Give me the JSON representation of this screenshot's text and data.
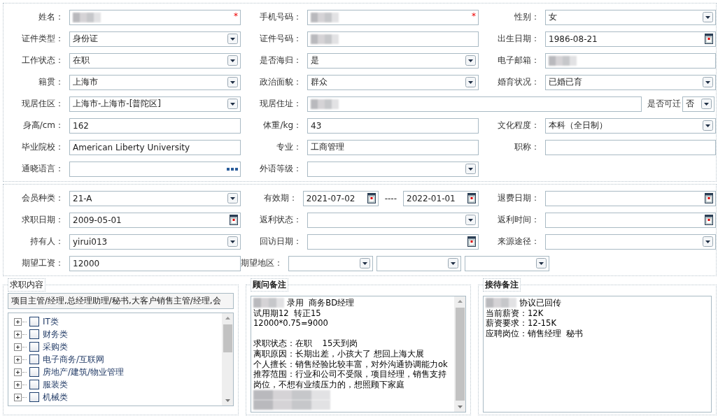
{
  "sections": [
    {
      "rows": [
        {
          "cells": [
            {
              "label": "姓名：",
              "fields": [
                {
                  "kind": "redacted",
                  "marker": "*"
                }
              ]
            },
            {
              "label": "手机号码：",
              "fields": [
                {
                  "kind": "redacted",
                  "marker": "*"
                }
              ]
            },
            {
              "label": "性别：",
              "fields": [
                {
                  "kind": "select",
                  "value": "女"
                }
              ]
            }
          ]
        },
        {
          "cells": [
            {
              "label": "证件类型：",
              "fields": [
                {
                  "kind": "select",
                  "value": "身份证"
                }
              ]
            },
            {
              "label": "证件号码：",
              "fields": [
                {
                  "kind": "redacted"
                }
              ]
            },
            {
              "label": "出生日期：",
              "fields": [
                {
                  "kind": "date",
                  "value": "1986-08-21"
                }
              ]
            }
          ]
        },
        {
          "cells": [
            {
              "label": "工作状态：",
              "fields": [
                {
                  "kind": "select",
                  "value": "在职"
                }
              ]
            },
            {
              "label": "是否海归：",
              "fields": [
                {
                  "kind": "select",
                  "value": "是"
                }
              ]
            },
            {
              "label": "电子邮箱：",
              "fields": [
                {
                  "kind": "redacted"
                }
              ]
            }
          ]
        },
        {
          "cells": [
            {
              "label": "籍贯：",
              "fields": [
                {
                  "kind": "select",
                  "value": "上海市"
                }
              ]
            },
            {
              "label": "政治面貌：",
              "fields": [
                {
                  "kind": "select",
                  "value": "群众"
                }
              ]
            },
            {
              "label": "婚育状况：",
              "fields": [
                {
                  "kind": "select",
                  "value": "已婚已育"
                }
              ]
            }
          ]
        },
        {
          "cells": [
            {
              "label": "现居住区：",
              "fields": [
                {
                  "kind": "select",
                  "value": "上海市-上海市-[普陀区]"
                }
              ]
            },
            {
              "label": "现居住址：",
              "fields": [
                {
                  "kind": "redacted"
                }
              ],
              "inline": {
                "label": "是否可迁",
                "field": {
                  "kind": "select",
                  "value": "否"
                }
              }
            }
          ]
        },
        {
          "cells": [
            {
              "label": "身高/cm：",
              "fields": [
                {
                  "kind": "text",
                  "value": "162"
                }
              ]
            },
            {
              "label": "体重/kg：",
              "fields": [
                {
                  "kind": "text",
                  "value": "43"
                }
              ]
            },
            {
              "label": "文化程度：",
              "fields": [
                {
                  "kind": "select",
                  "value": "本科（全日制）"
                }
              ]
            }
          ]
        },
        {
          "cells": [
            {
              "label": "毕业院校：",
              "fields": [
                {
                  "kind": "text",
                  "value": "American Liberty University"
                }
              ]
            },
            {
              "label": "专业：",
              "fields": [
                {
                  "kind": "text",
                  "value": "工商管理"
                }
              ]
            },
            {
              "label": "职称：",
              "fields": [
                {
                  "kind": "text"
                }
              ]
            }
          ]
        },
        {
          "cells": [
            {
              "label": "通晓语言：",
              "fields": [
                {
                  "kind": "picker"
                }
              ]
            },
            {
              "label": "外语等级：",
              "fields": [
                {
                  "kind": "select"
                }
              ]
            }
          ]
        }
      ]
    },
    {
      "rows": [
        {
          "cells": [
            {
              "label": "会员种类：",
              "fields": [
                {
                  "kind": "select",
                  "value": "21-A"
                }
              ]
            },
            {
              "label": "有效期：",
              "fields": [
                {
                  "kind": "date",
                  "value": "2021-07-02"
                },
                {
                  "kind": "separator",
                  "text": "----"
                },
                {
                  "kind": "date",
                  "value": "2022-01-01"
                }
              ]
            },
            {
              "label": "退费日期：",
              "fields": [
                {
                  "kind": "date"
                }
              ]
            }
          ]
        },
        {
          "cells": [
            {
              "label": "求职日期：",
              "fields": [
                {
                  "kind": "date",
                  "value": "2009-05-01"
                }
              ]
            },
            {
              "label": "返利状态：",
              "fields": [
                {
                  "kind": "select"
                }
              ]
            },
            {
              "label": "返利时间：",
              "fields": [
                {
                  "kind": "date"
                }
              ]
            }
          ]
        },
        {
          "cells": [
            {
              "label": "持有人：",
              "fields": [
                {
                  "kind": "select",
                  "value": "yirui013"
                }
              ]
            },
            {
              "label": "回访日期：",
              "fields": [
                {
                  "kind": "date"
                }
              ]
            },
            {
              "label": "来源途径：",
              "fields": [
                {
                  "kind": "select"
                }
              ]
            }
          ]
        },
        {
          "cells": [
            {
              "label": "期望工资：",
              "fields": [
                {
                  "kind": "text",
                  "value": "12000"
                }
              ]
            },
            {
              "label": "期望地区：",
              "fields": [
                {
                  "kind": "select"
                },
                {
                  "kind": "select"
                },
                {
                  "kind": "select"
                }
              ]
            }
          ]
        }
      ]
    }
  ],
  "job_content": {
    "title": "求职内容",
    "summary": "项目主管/经理,总经理助理/秘书,大客户销售主管/经理,会",
    "tree": [
      {
        "label": "IT类",
        "expanded": false,
        "checked": false
      },
      {
        "label": "财务类",
        "expanded": false,
        "checked": false
      },
      {
        "label": "采购类",
        "expanded": false,
        "checked": false
      },
      {
        "label": "电子商务/互联网",
        "expanded": false,
        "checked": false
      },
      {
        "label": "房地产/建筑/物业管理",
        "expanded": false,
        "checked": false
      },
      {
        "label": "服装类",
        "expanded": false,
        "checked": false
      },
      {
        "label": "机械类",
        "expanded": false,
        "checked": false
      }
    ]
  },
  "consultant_notes": {
    "title": "顾问备注",
    "lines": [
      {
        "kind": "text",
        "prefix_redacted": true,
        "text": "录用  商务BD经理"
      },
      {
        "kind": "text",
        "prefix_redacted": false,
        "text": "试用期12  转正15"
      },
      {
        "kind": "text",
        "prefix_redacted": false,
        "text": "12000*0.75=9000"
      },
      {
        "kind": "blank",
        "prefix_redacted": false
      },
      {
        "kind": "text",
        "prefix_redacted": false,
        "text": "求职状态：在职    15天到岗"
      },
      {
        "kind": "text",
        "prefix_redacted": false,
        "text": "离职原因：长期出差，小孩大了 想回上海大展"
      },
      {
        "kind": "text",
        "prefix_redacted": false,
        "text": "个人擅长：销售经验比较丰富，对外沟通协调能力ok"
      },
      {
        "kind": "text",
        "prefix_redacted": false,
        "text": "推荐范围：行业和公司不受限，项目经理，销售支持"
      },
      {
        "kind": "text",
        "prefix_redacted": false,
        "text": "岗位，不想有业绩压力的，想照顾下家庭"
      },
      {
        "kind": "redacted",
        "prefix_redacted": false
      },
      {
        "kind": "redacted",
        "prefix_redacted": false
      }
    ]
  },
  "reception_notes": {
    "title": "接待备注",
    "lines": [
      {
        "kind": "text",
        "prefix_redacted": true,
        "text": "协议已回传"
      },
      {
        "kind": "text",
        "prefix_redacted": false,
        "text": "当前薪资：12K"
      },
      {
        "kind": "text",
        "prefix_redacted": false,
        "text": "薪资要求：12-15K"
      },
      {
        "kind": "text",
        "prefix_redacted": false,
        "text": "应聘岗位：销售经理  秘书"
      }
    ]
  }
}
